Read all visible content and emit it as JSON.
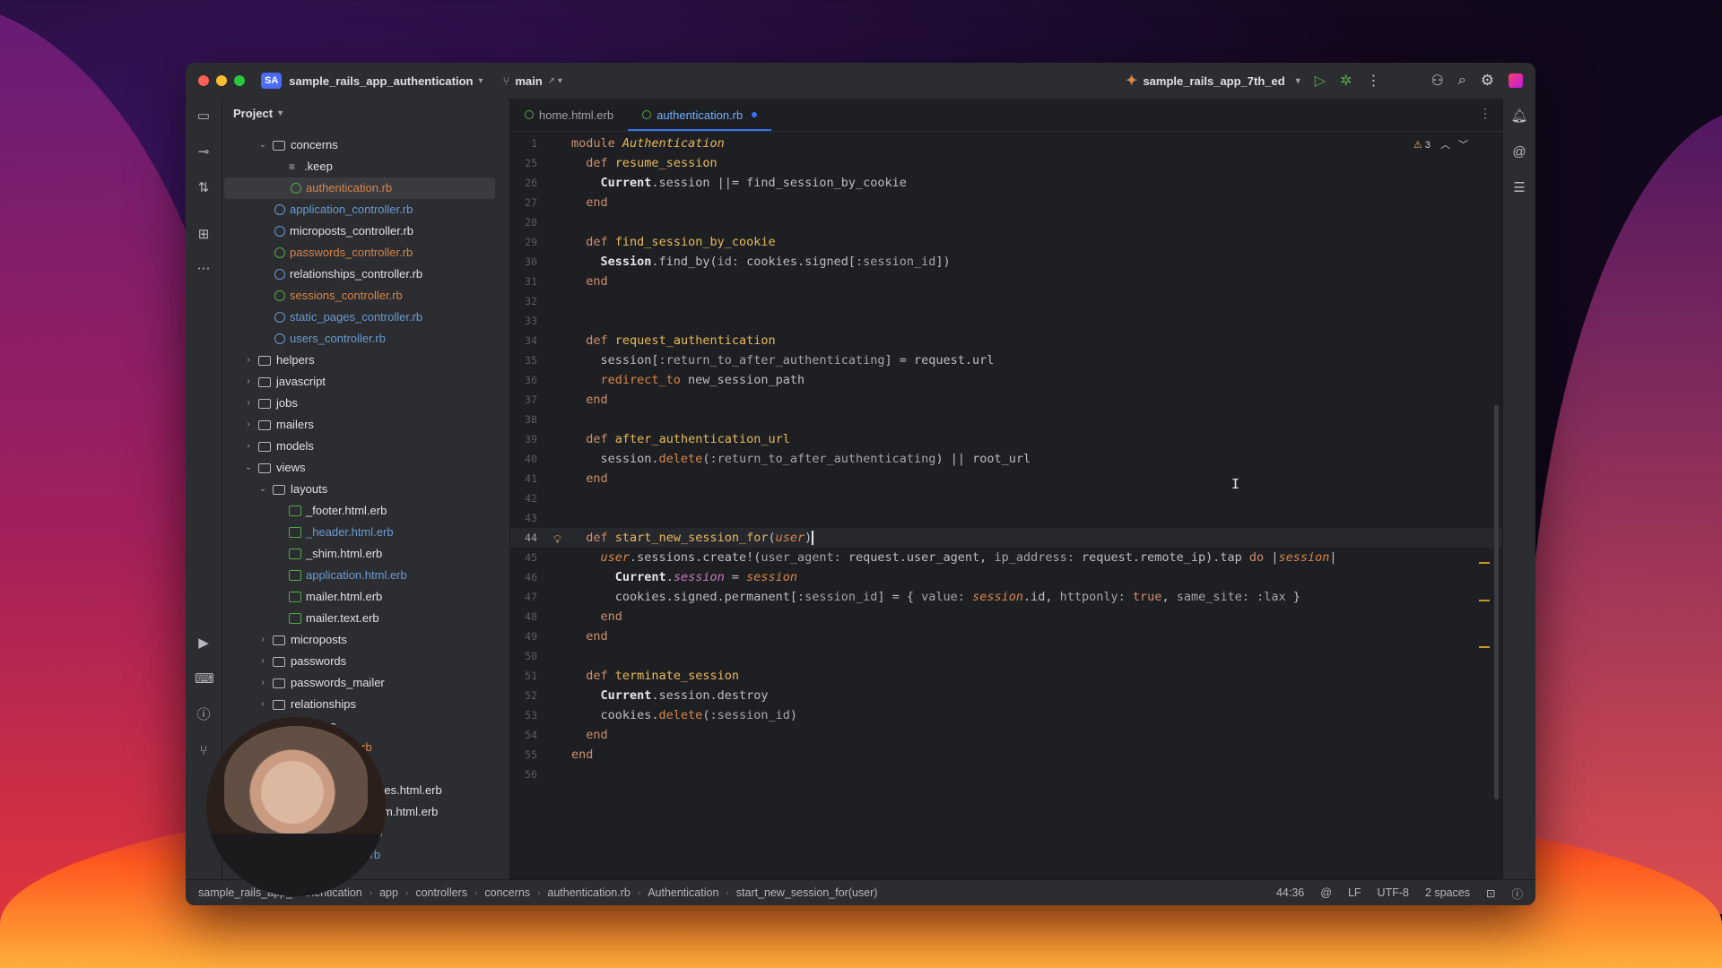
{
  "window": {
    "project_badge": "SA",
    "project_name": "sample_rails_app_authentication",
    "branch": "main",
    "run_config": "sample_rails_app_7th_ed"
  },
  "project_panel": {
    "title": "Project",
    "tree": [
      {
        "label": "concerns",
        "kind": "folder",
        "expanded": true,
        "indent": 2,
        "color": "white"
      },
      {
        "label": ".keep",
        "kind": "text",
        "indent": 3,
        "color": "white"
      },
      {
        "label": "authentication.rb",
        "kind": "ruby",
        "indent": 3,
        "color": "orange",
        "selected": true
      },
      {
        "label": "application_controller.rb",
        "kind": "ruby",
        "indent": 2,
        "color": "blue"
      },
      {
        "label": "microposts_controller.rb",
        "kind": "ruby",
        "indent": 2,
        "color": "white"
      },
      {
        "label": "passwords_controller.rb",
        "kind": "ruby",
        "indent": 2,
        "color": "orange"
      },
      {
        "label": "relationships_controller.rb",
        "kind": "ruby",
        "indent": 2,
        "color": "white"
      },
      {
        "label": "sessions_controller.rb",
        "kind": "ruby",
        "indent": 2,
        "color": "orange"
      },
      {
        "label": "static_pages_controller.rb",
        "kind": "ruby",
        "indent": 2,
        "color": "blue"
      },
      {
        "label": "users_controller.rb",
        "kind": "ruby",
        "indent": 2,
        "color": "blue"
      },
      {
        "label": "helpers",
        "kind": "folder",
        "expanded": false,
        "indent": 1,
        "color": "white"
      },
      {
        "label": "javascript",
        "kind": "folder",
        "expanded": false,
        "indent": 1,
        "color": "white"
      },
      {
        "label": "jobs",
        "kind": "folder",
        "expanded": false,
        "indent": 1,
        "color": "white"
      },
      {
        "label": "mailers",
        "kind": "folder",
        "expanded": false,
        "indent": 1,
        "color": "white"
      },
      {
        "label": "models",
        "kind": "folder",
        "expanded": false,
        "indent": 1,
        "color": "white"
      },
      {
        "label": "views",
        "kind": "folder",
        "expanded": true,
        "indent": 1,
        "color": "white"
      },
      {
        "label": "layouts",
        "kind": "folder",
        "expanded": true,
        "indent": 2,
        "color": "white"
      },
      {
        "label": "_footer.html.erb",
        "kind": "erb",
        "indent": 3,
        "color": "white"
      },
      {
        "label": "_header.html.erb",
        "kind": "erb",
        "indent": 3,
        "color": "blue"
      },
      {
        "label": "_shim.html.erb",
        "kind": "erb",
        "indent": 3,
        "color": "white"
      },
      {
        "label": "application.html.erb",
        "kind": "erb",
        "indent": 3,
        "color": "blue"
      },
      {
        "label": "mailer.html.erb",
        "kind": "erb",
        "indent": 3,
        "color": "white"
      },
      {
        "label": "mailer.text.erb",
        "kind": "erb",
        "indent": 3,
        "color": "white"
      },
      {
        "label": "microposts",
        "kind": "folder",
        "expanded": false,
        "indent": 2,
        "color": "white"
      },
      {
        "label": "passwords",
        "kind": "folder",
        "expanded": false,
        "indent": 2,
        "color": "white"
      },
      {
        "label": "passwords_mailer",
        "kind": "folder",
        "expanded": false,
        "indent": 2,
        "color": "white"
      },
      {
        "label": "relationships",
        "kind": "folder",
        "expanded": false,
        "indent": 2,
        "color": "white"
      },
      {
        "label": "sessions",
        "kind": "folder",
        "expanded": true,
        "indent": 2,
        "color": "white"
      },
      {
        "label": "new.html.erb",
        "kind": "erb",
        "indent": 3,
        "color": "orange"
      },
      {
        "label": "shared",
        "kind": "folder",
        "expanded": false,
        "indent": 2,
        "color": "white"
      },
      {
        "label": "_error_messages.html.erb",
        "kind": "erb",
        "indent": 3,
        "color": "white"
      },
      {
        "label": "_micropost_form.html.erb",
        "kind": "erb",
        "indent": 3,
        "color": "white"
      },
      {
        "label": "_stats.html.erb",
        "kind": "erb",
        "indent": 3,
        "color": "white"
      },
      {
        "label": "home.html.erb",
        "kind": "erb",
        "indent": 3,
        "color": "blue"
      }
    ]
  },
  "tabs": [
    {
      "label": "home.html.erb",
      "active": false
    },
    {
      "label": "authentication.rb",
      "active": true,
      "modified": true
    }
  ],
  "warnings": {
    "count": "3"
  },
  "code_lines": [
    {
      "n": "1",
      "html": "<span class='kw'>module</span> <span class='mod'>Authentication</span>"
    },
    {
      "n": "25",
      "html": "  <span class='kw'>def</span> <span class='fn'>resume_session</span>"
    },
    {
      "n": "26",
      "html": "    <span class='cls'>Current</span>.session ||= find_session_by_cookie"
    },
    {
      "n": "27",
      "html": "  <span class='kw'>end</span>"
    },
    {
      "n": "28",
      "html": ""
    },
    {
      "n": "29",
      "html": "  <span class='kw'>def</span> <span class='fn'>find_session_by_cookie</span>"
    },
    {
      "n": "30",
      "html": "    <span class='cls'>Session</span>.find_by(<span class='sym'>id:</span> cookies.signed[<span class='sym'>:session_id</span>])"
    },
    {
      "n": "31",
      "html": "  <span class='kw'>end</span>"
    },
    {
      "n": "32",
      "html": ""
    },
    {
      "n": "33",
      "html": ""
    },
    {
      "n": "34",
      "html": "  <span class='kw'>def</span> <span class='fn'>request_authentication</span>"
    },
    {
      "n": "35",
      "html": "    session[<span class='sym'>:return_to_after_authenticating</span>] = request.url"
    },
    {
      "n": "36",
      "html": "    <span class='meth'>redirect_to</span> new_session_path"
    },
    {
      "n": "37",
      "html": "  <span class='kw'>end</span>"
    },
    {
      "n": "38",
      "html": ""
    },
    {
      "n": "39",
      "html": "  <span class='kw'>def</span> <span class='fn'>after_authentication_url</span>"
    },
    {
      "n": "40",
      "html": "    session.<span class='meth'>delete</span>(<span class='sym'>:return_to_after_authenticating</span>) || root_url"
    },
    {
      "n": "41",
      "html": "  <span class='kw'>end</span>"
    },
    {
      "n": "42",
      "html": ""
    },
    {
      "n": "43",
      "html": ""
    },
    {
      "n": "44",
      "html": "  <span class='kw'>def</span> <span class='fn'>start_new_session_for</span>(<span class='prm'>user</span>)<span class='cursor'></span>",
      "current": true,
      "bulb": true
    },
    {
      "n": "45",
      "html": "    <span class='prm'>user</span>.sessions.create!(<span class='sym'>user_agent:</span> request.user_agent, <span class='sym'>ip_address:</span> request.remote_ip).tap <span class='kw'>do</span> |<span class='prm'>session</span>|"
    },
    {
      "n": "46",
      "html": "      <span class='cls'>Current</span>.<span class='ivar'>session</span> = <span class='prm'>session</span>"
    },
    {
      "n": "47",
      "html": "      cookies.signed.permanent[<span class='sym'>:session_id</span>] = { <span class='sym'>value:</span> <span class='prm'>session</span>.id, <span class='sym'>httponly:</span> <span class='bool'>true</span>, <span class='sym'>same_site:</span> <span class='sym'>:lax</span> }"
    },
    {
      "n": "48",
      "html": "    <span class='kw'>end</span>"
    },
    {
      "n": "49",
      "html": "  <span class='kw'>end</span>"
    },
    {
      "n": "50",
      "html": ""
    },
    {
      "n": "51",
      "html": "  <span class='kw'>def</span> <span class='fn'>terminate_session</span>"
    },
    {
      "n": "52",
      "html": "    <span class='cls'>Current</span>.session.destroy"
    },
    {
      "n": "53",
      "html": "    cookies.<span class='meth'>delete</span>(<span class='sym'>:session_id</span>)"
    },
    {
      "n": "54",
      "html": "  <span class='kw'>end</span>"
    },
    {
      "n": "55",
      "html": "<span class='kw'>end</span>"
    },
    {
      "n": "56",
      "html": ""
    }
  ],
  "breadcrumbs": [
    "sample_rails_app_authentication",
    "app",
    "controllers",
    "concerns",
    "authentication.rb",
    "Authentication",
    "start_new_session_for(user)"
  ],
  "status": {
    "position": "44:36",
    "line_ending": "LF",
    "encoding": "UTF-8",
    "indent": "2 spaces"
  },
  "colors": {
    "accent": "#3574f0",
    "background": "#1e1f22",
    "panel": "#2b2d30"
  }
}
